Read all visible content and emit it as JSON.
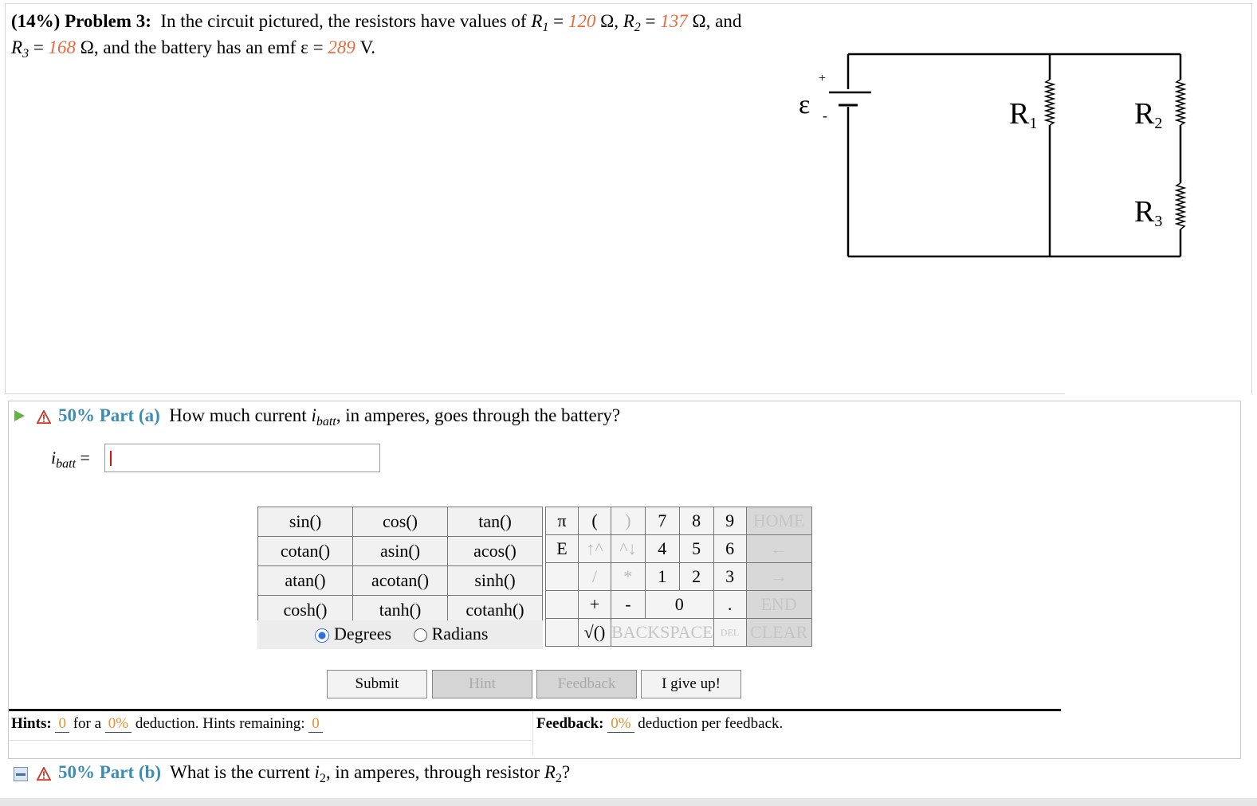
{
  "problem": {
    "weight": "(14%)",
    "label": "Problem 3:",
    "text1": "In the circuit pictured, the resistors have values of",
    "r1_sym": "R",
    "r1_sub": "1",
    "eq": "=",
    "r1_val": "120",
    "ohm": "Ω,",
    "r2_sym": "R",
    "r2_sub": "2",
    "r2_val": "137",
    "r2_tail": "Ω, and",
    "r3_sym": "R",
    "r3_sub": "3",
    "r3_val": "168",
    "r3_tail": "Ω, and the battery has an emf ε =",
    "emf_val": "289",
    "emf_unit": "V."
  },
  "circuit": {
    "emf_label": "ε",
    "plus": "+",
    "minus": "-",
    "r1": "R",
    "r1_sub": "1",
    "r2": "R",
    "r2_sub": "2",
    "r3": "R",
    "r3_sub": "3"
  },
  "part_a": {
    "title": "50% Part (a)",
    "question_pre": "How much current",
    "var": "i",
    "var_sub": "batt",
    "question_post": ", in amperes, goes through the battery?",
    "answer_label": "i",
    "answer_sub": "batt",
    "answer_eq": "=",
    "answer_value": ""
  },
  "calculator": {
    "functions": [
      [
        "sin()",
        "cos()",
        "tan()"
      ],
      [
        "cotan()",
        "asin()",
        "acos()"
      ],
      [
        "atan()",
        "acotan()",
        "sinh()"
      ],
      [
        "cosh()",
        "tanh()",
        "cotanh()"
      ]
    ],
    "degrees_label": "Degrees",
    "radians_label": "Radians",
    "angle_mode": "Degrees",
    "keys": {
      "pi": "π",
      "open_paren": "(",
      "close_paren": ")",
      "k7": "7",
      "k8": "8",
      "k9": "9",
      "home": "HOME",
      "E": "E",
      "up": "↑^",
      "down": "^↓",
      "k4": "4",
      "k5": "5",
      "k6": "6",
      "left": "←",
      "slash": "/",
      "star": "*",
      "k1": "1",
      "k2": "2",
      "k3": "3",
      "right": "→",
      "plus": "+",
      "minus": "-",
      "k0": "0",
      "dot": ".",
      "end": "END",
      "sqrt": "√()",
      "backspace": "BACKSPACE",
      "del": "DEL",
      "clear": "CLEAR"
    }
  },
  "buttons": {
    "submit": "Submit",
    "hint": "Hint",
    "feedback": "Feedback",
    "give_up": "I give up!"
  },
  "hints": {
    "label": "Hints:",
    "count": "0",
    "for_a": "for a",
    "pct": "0%",
    "deduction": "deduction. Hints remaining:",
    "remaining": "0"
  },
  "feedback": {
    "label": "Feedback:",
    "pct": "0%",
    "text": "deduction per feedback."
  },
  "part_b": {
    "title": "50% Part (b)",
    "question_pre": "What is the current",
    "var": "i",
    "var_sub": "2",
    "question_mid": ", in amperes, through resistor",
    "res": "R",
    "res_sub": "2",
    "question_post": "?"
  },
  "colors": {
    "given_value": "#e86b3e",
    "part_title": "#3b8db5",
    "hint_value": "#e8902f"
  }
}
